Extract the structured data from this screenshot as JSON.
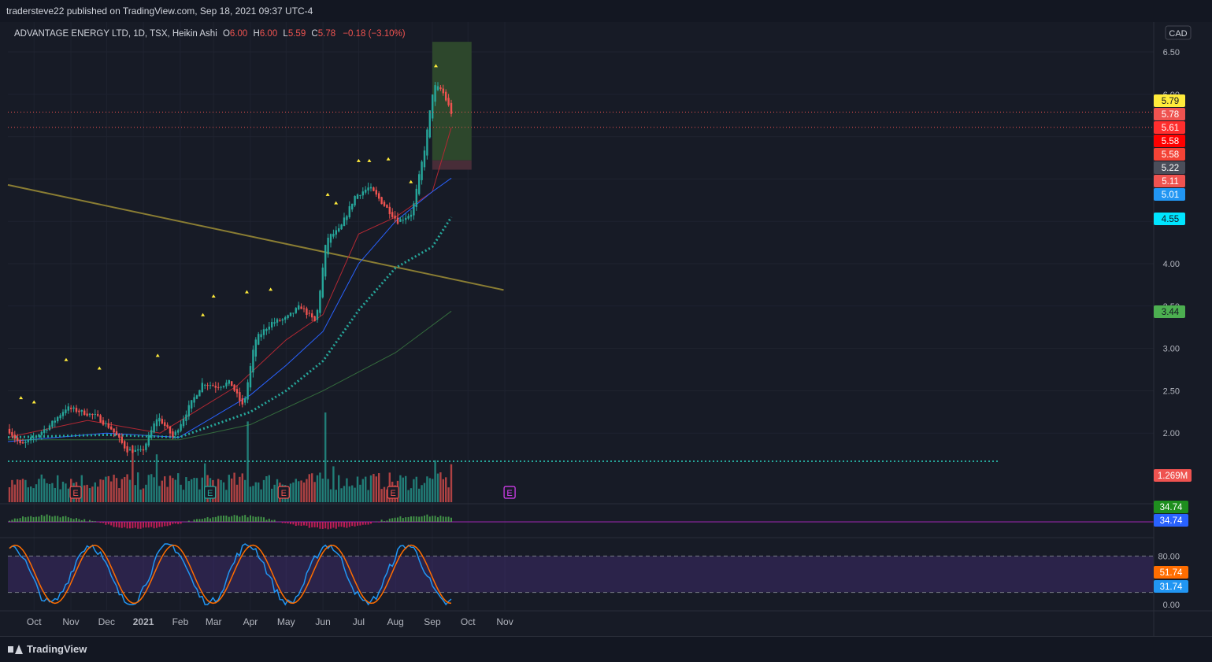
{
  "publish": {
    "text": "tradersteve22 published on TradingView.com, Sep 18, 2021 09:37 UTC-4"
  },
  "header": {
    "symbol": "ADVANTAGE ENERGY LTD, 1D, TSX, Heikin Ashi",
    "o_label": "O",
    "o_value": "6.00",
    "h_label": "H",
    "h_value": "6.00",
    "l_label": "L",
    "l_value": "5.59",
    "c_label": "C",
    "c_value": "5.78",
    "change": "−0.18 (−3.10%)"
  },
  "currency": "CAD",
  "footer": {
    "brand": "TradingView"
  },
  "colors": {
    "up": "#26a69a",
    "down": "#ef5350",
    "background": "#171b26",
    "trendline": "#8a7d33",
    "ma_fast": "#b22833",
    "ma_mid": "#2962ff",
    "ma_slow_dotted": "#26a69a",
    "ma_200": "#4caf50",
    "rsi_band": "#673ab7"
  },
  "chart_data": [
    {
      "type": "line",
      "title": "ADVANTAGE ENERGY LTD, 1D, TSX, Heikin Ashi",
      "candle_style": "Heikin Ashi",
      "ohlc": {
        "open": 6.0,
        "high": 6.0,
        "low": 5.59,
        "close": 5.78,
        "change": -0.18,
        "change_pct": -3.1
      },
      "x_tick_labels": [
        "Oct",
        "Nov",
        "Dec",
        "2021",
        "Feb",
        "Mar",
        "Apr",
        "May",
        "Jun",
        "Jul",
        "Aug",
        "Sep",
        "Oct",
        "Nov"
      ],
      "y_tick_labels": [
        "6.50",
        "6.00",
        "3.50",
        "3.00",
        "2.50",
        "2.00",
        "4.00"
      ],
      "ylim": [
        1.5,
        6.7
      ],
      "grid": true,
      "price_path": {
        "x": [
          "2020-09-09",
          "2020-09-20",
          "2020-10-01",
          "2020-10-15",
          "2020-10-28",
          "2020-11-10",
          "2020-11-22",
          "2020-12-05",
          "2020-12-18",
          "2020-12-31",
          "2021-01-13",
          "2021-01-26",
          "2021-02-08",
          "2021-02-20",
          "2021-03-03",
          "2021-03-15",
          "2021-03-26",
          "2021-04-05",
          "2021-04-18",
          "2021-05-01",
          "2021-05-13",
          "2021-05-26",
          "2021-06-04",
          "2021-06-15",
          "2021-06-28",
          "2021-07-10",
          "2021-07-22",
          "2021-08-03",
          "2021-08-15",
          "2021-08-26",
          "2021-09-02",
          "2021-09-09",
          "2021-09-17"
        ],
        "close": [
          2.05,
          1.85,
          1.95,
          2.1,
          2.3,
          2.25,
          2.2,
          2.05,
          1.8,
          1.78,
          2.2,
          1.95,
          2.3,
          2.6,
          2.55,
          2.6,
          2.3,
          3.1,
          3.3,
          3.35,
          3.5,
          3.3,
          4.3,
          4.4,
          4.8,
          4.9,
          4.7,
          4.5,
          4.6,
          5.4,
          6.1,
          6.05,
          5.78
        ]
      },
      "series": [
        {
          "name": "Trendline",
          "x": [
            "2020-09-09",
            "2021-10-31"
          ],
          "values": [
            4.93,
            3.69
          ]
        },
        {
          "name": "MA fast",
          "x": [
            "2020-09-09",
            "2020-11-15",
            "2021-01-15",
            "2021-03-20",
            "2021-05-01",
            "2021-06-01",
            "2021-07-01",
            "2021-08-01",
            "2021-09-01",
            "2021-09-17"
          ],
          "values": [
            1.95,
            2.15,
            2.0,
            2.55,
            3.1,
            3.4,
            4.35,
            4.55,
            4.85,
            5.61
          ]
        },
        {
          "name": "MA mid",
          "x": [
            "2020-09-09",
            "2020-12-01",
            "2021-01-31",
            "2021-04-01",
            "2021-05-01",
            "2021-06-01",
            "2021-07-01",
            "2021-08-01",
            "2021-09-01",
            "2021-09-17"
          ],
          "values": [
            1.9,
            2.0,
            1.95,
            2.45,
            2.8,
            3.2,
            4.0,
            4.5,
            4.85,
            5.01
          ]
        },
        {
          "name": "MA 50 dotted",
          "x": [
            "2020-09-09",
            "2020-12-01",
            "2021-01-31",
            "2021-04-01",
            "2021-05-01",
            "2021-06-01",
            "2021-07-01",
            "2021-08-01",
            "2021-09-01",
            "2021-09-17"
          ],
          "values": [
            1.95,
            1.98,
            1.95,
            2.25,
            2.5,
            2.85,
            3.45,
            3.95,
            4.2,
            4.55
          ]
        },
        {
          "name": "MA 200",
          "x": [
            "2020-09-09",
            "2021-01-31",
            "2021-04-01",
            "2021-06-01",
            "2021-08-01",
            "2021-09-17"
          ],
          "values": [
            1.92,
            1.92,
            2.1,
            2.5,
            2.95,
            3.44
          ]
        }
      ],
      "swing_high_markers": [
        2.4,
        2.35,
        2.85,
        2.75,
        2.9,
        3.38,
        3.6,
        3.65,
        3.68,
        4.8,
        4.7,
        5.2,
        5.2,
        5.22,
        4.95,
        6.32
      ],
      "position_box": {
        "entry": 5.22,
        "target": 6.62,
        "stop": 5.11,
        "from": "2021-09-01",
        "to": "2021-10-04",
        "target_zone_color": "#2e4a2c",
        "stop_zone_color": "#4b2e39"
      },
      "dotted_lines": [
        {
          "value": 5.79,
          "color": "#ef5350"
        },
        {
          "value": 5.61,
          "color": "#ef5350"
        }
      ],
      "price_labels": [
        {
          "text": "5.79",
          "value": 5.79,
          "bg": "#ffeb3b",
          "fg": "#131722"
        },
        {
          "text": "5.78",
          "value": 5.78,
          "bg": "#ef5350",
          "fg": "#ffffff"
        },
        {
          "text": "5.61",
          "value": 5.61,
          "bg": "#ff2e2e",
          "fg": "#ffffff"
        },
        {
          "text": "5.58",
          "value": 5.58,
          "bg": "#ff0000",
          "fg": "#ffffff"
        },
        {
          "text": "5.58",
          "value": 5.58,
          "bg": "#f44336",
          "fg": "#ffffff"
        },
        {
          "text": "5.22",
          "value": 5.22,
          "bg": "#4a4e5a",
          "fg": "#ffffff"
        },
        {
          "text": "5.11",
          "value": 5.11,
          "bg": "#ef5350",
          "fg": "#ffffff"
        },
        {
          "text": "5.01",
          "value": 5.01,
          "bg": "#2196f3",
          "fg": "#ffffff"
        },
        {
          "text": "4.55",
          "value": 4.55,
          "bg": "#00e5ff",
          "fg": "#131722"
        },
        {
          "text": "3.44",
          "value": 3.44,
          "bg": "#4caf50",
          "fg": "#131722"
        }
      ],
      "earnings_markers": [
        {
          "label": "E",
          "color": "#ef5350",
          "x": "2020-11-05"
        },
        {
          "label": "E",
          "color": "#26a69a",
          "x": "2021-02-26"
        },
        {
          "label": "E",
          "color": "#ef5350",
          "x": "2021-04-29"
        },
        {
          "label": "E",
          "color": "#ef5350",
          "x": "2021-07-30"
        },
        {
          "label": "E",
          "color": "#e040fb",
          "x": "2021-11-05"
        }
      ]
    },
    {
      "type": "bar",
      "title": "Volume",
      "last_label": "1.269M",
      "peaks": [
        {
          "x": "2020-09-10",
          "value": 0.5
        },
        {
          "x": "2020-10-20",
          "value": 0.9
        },
        {
          "x": "2020-12-23",
          "value": 1.9
        },
        {
          "x": "2021-01-13",
          "value": 1.6
        },
        {
          "x": "2021-02-22",
          "value": 1.3
        },
        {
          "x": "2021-03-30",
          "value": 2.7
        },
        {
          "x": "2021-06-03",
          "value": 3.0
        },
        {
          "x": "2021-06-10",
          "value": 1.2
        },
        {
          "x": "2021-09-03",
          "value": 1.4
        },
        {
          "x": "2021-09-17",
          "value": 1.269
        }
      ]
    },
    {
      "type": "bar",
      "title": "MACD histogram",
      "last_labels": [
        {
          "text": "34.74",
          "bg": "#1e8e1e"
        },
        {
          "text": "34.74",
          "bg": "#2962ff"
        }
      ]
    },
    {
      "type": "line",
      "title": "Stochastic RSI",
      "y_tick_labels": [
        "80.00",
        "0.00"
      ],
      "band": [
        20,
        80
      ],
      "series": [
        {
          "name": "K",
          "color": "#2196f3",
          "last": 31.74
        },
        {
          "name": "D",
          "color": "#ff6d00",
          "last": 51.74
        }
      ],
      "last_labels": [
        {
          "text": "51.74",
          "bg": "#ff6d00"
        },
        {
          "text": "31.74",
          "bg": "#2196f3"
        }
      ]
    }
  ]
}
